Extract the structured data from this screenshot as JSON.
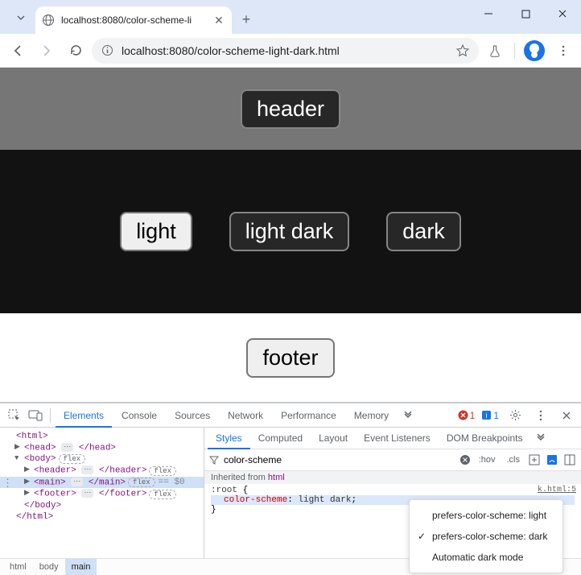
{
  "window": {
    "tab_title": "localhost:8080/color-scheme-li",
    "url_display": "localhost:8080/color-scheme-light-dark.html"
  },
  "page": {
    "header_label": "header",
    "main_buttons": [
      "light",
      "light dark",
      "dark"
    ],
    "footer_label": "footer"
  },
  "devtools": {
    "main_tabs": [
      "Elements",
      "Console",
      "Sources",
      "Network",
      "Performance",
      "Memory"
    ],
    "error_count": "1",
    "info_count": "1",
    "styles_tabs": [
      "Styles",
      "Computed",
      "Layout",
      "Event Listeners",
      "DOM Breakpoints"
    ],
    "filter_value": "color-scheme",
    "hov_label": ":hov",
    "cls_label": ".cls",
    "inherited_label": "Inherited from ",
    "inherited_el": "html",
    "rule_selector": ":root",
    "rule_prop": "color-scheme",
    "rule_val": "light dark",
    "rule_source": "k.html:5",
    "dom": {
      "html_open": "<html>",
      "head": "<head>",
      "head_close": "</head>",
      "body_open": "<body>",
      "header": "<header>",
      "header_close": "</header>",
      "main": "<main>",
      "main_close": "</main>",
      "footer": "<footer>",
      "footer_close": "</footer>",
      "body_close": "</body>",
      "html_close": "</html>",
      "flex_badge": "flex",
      "selected_eq": "== $0"
    },
    "breadcrumbs": [
      "html",
      "body",
      "main"
    ],
    "emulation": {
      "opt1": "prefers-color-scheme: light",
      "opt2": "prefers-color-scheme: dark",
      "opt3": "Automatic dark mode",
      "check": "✓"
    }
  }
}
